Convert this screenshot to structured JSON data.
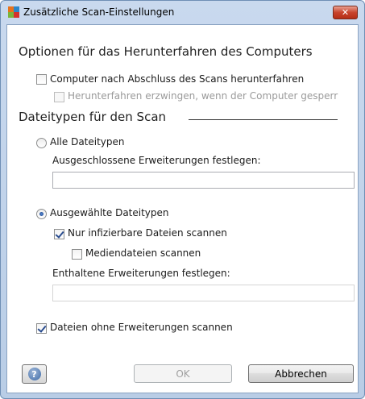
{
  "window": {
    "title": "Zusätzliche Scan-Einstellungen",
    "close_label": "✕"
  },
  "shutdown": {
    "heading": "Optionen für das Herunterfahren des Computers",
    "shutdown_after_scan": {
      "label": "Computer nach Abschluss des Scans herunterfahren",
      "checked": false
    },
    "force_shutdown": {
      "label": "Herunterfahren erzwingen, wenn der Computer gesperr",
      "checked": false,
      "enabled": false
    }
  },
  "filetypes": {
    "heading": "Dateitypen für den Scan",
    "all_types": {
      "label": "Alle Dateitypen",
      "selected": false
    },
    "excluded_ext": {
      "label": "Ausgeschlossene Erweiterungen festlegen:",
      "value": ""
    },
    "selected_types": {
      "label": "Ausgewählte Dateitypen",
      "selected": true
    },
    "infectable_only": {
      "label": "Nur infizierbare Dateien scannen",
      "checked": true
    },
    "media_files": {
      "label": "Mediendateien scannen",
      "checked": false
    },
    "included_ext": {
      "label": "Enthaltene Erweiterungen festlegen:",
      "value": ""
    },
    "no_extension": {
      "label": "Dateien ohne Erweiterungen scannen",
      "checked": true
    }
  },
  "footer": {
    "help_glyph": "?",
    "ok_label": "OK",
    "cancel_label": "Abbrechen"
  }
}
